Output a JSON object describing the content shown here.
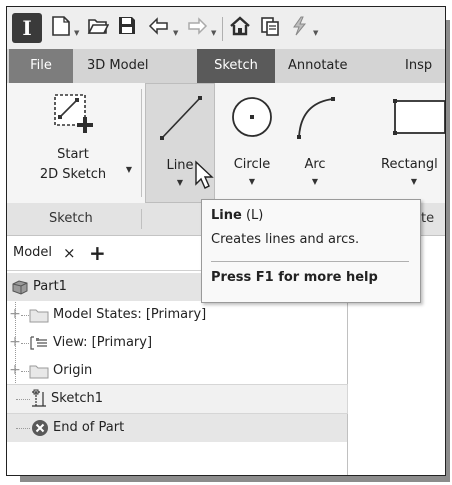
{
  "app": {
    "logo": "I"
  },
  "qat": {
    "icons": [
      "new-icon",
      "open-icon",
      "save-icon",
      "undo-icon",
      "redo-icon",
      "home-icon",
      "copy-icon",
      "update-icon"
    ]
  },
  "tabs": [
    "File",
    "3D Model",
    "Sketch",
    "Annotate",
    "Insp"
  ],
  "ribbon": {
    "start_label_1": "Start",
    "start_label_2": "2D Sketch",
    "line_label": "Line",
    "circle_label": "Circle",
    "arc_label": "Arc",
    "rect_label": "Rectangl",
    "panel_sketch": "Sketch",
    "panel_create_fragment": "te"
  },
  "tooltip": {
    "title": "Line",
    "shortcut": " (L)",
    "description": "Creates lines and arcs.",
    "help": "Press F1 for more help"
  },
  "browser": {
    "tab_label": "Model",
    "close_glyph": "×",
    "add_glyph": "+",
    "nodes": [
      {
        "label": "Part1"
      },
      {
        "label": "Model States: [Primary]"
      },
      {
        "label": "View: [Primary]"
      },
      {
        "label": "Origin"
      },
      {
        "label": "Sketch1"
      },
      {
        "label": "End of Part"
      }
    ]
  },
  "colors": {
    "active_tab": "#5a5a5a",
    "file_tab": "#7d7d7d",
    "tab_bar": "#d4d4d4",
    "end_icon": "#595959"
  }
}
